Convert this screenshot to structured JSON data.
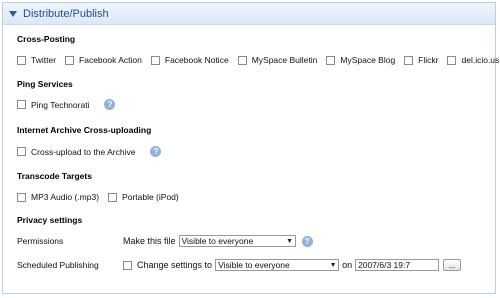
{
  "header": {
    "title": "Distribute/Publish"
  },
  "cross_posting": {
    "heading": "Cross-Posting",
    "items": [
      {
        "label": "Twitter"
      },
      {
        "label": "Facebook Action"
      },
      {
        "label": "Facebook Notice"
      },
      {
        "label": "MySpace Bulletin"
      },
      {
        "label": "MySpace Blog"
      },
      {
        "label": "Flickr"
      },
      {
        "label": "del.icio.us"
      }
    ]
  },
  "ping": {
    "heading": "Ping Services",
    "item": "Ping Technorati"
  },
  "archive": {
    "heading": "Internet Archive Cross-uploading",
    "item": "Cross-upload to the Archive"
  },
  "transcode": {
    "heading": "Transcode Targets",
    "items": [
      {
        "label": "MP3 Audio (.mp3)"
      },
      {
        "label": "Portable (iPod)"
      }
    ]
  },
  "privacy": {
    "heading": "Privacy settings",
    "permissions_label": "Permissions",
    "make_file_label": "Make this file",
    "visibility_value": "Visible to everyone",
    "scheduled_label": "Scheduled Publishing",
    "change_label": "Change settings to",
    "scheduled_value": "Visible to everyone",
    "on_label": "on",
    "date_value": "2007/6/3 19:7",
    "browse_label": "..."
  },
  "icons": {
    "help": "help-icon",
    "disclosure": "disclosure-triangle-icon"
  },
  "colors": {
    "header_text": "#1d4f8c",
    "border": "#b9cfe6",
    "help": "#8fb1dc"
  }
}
